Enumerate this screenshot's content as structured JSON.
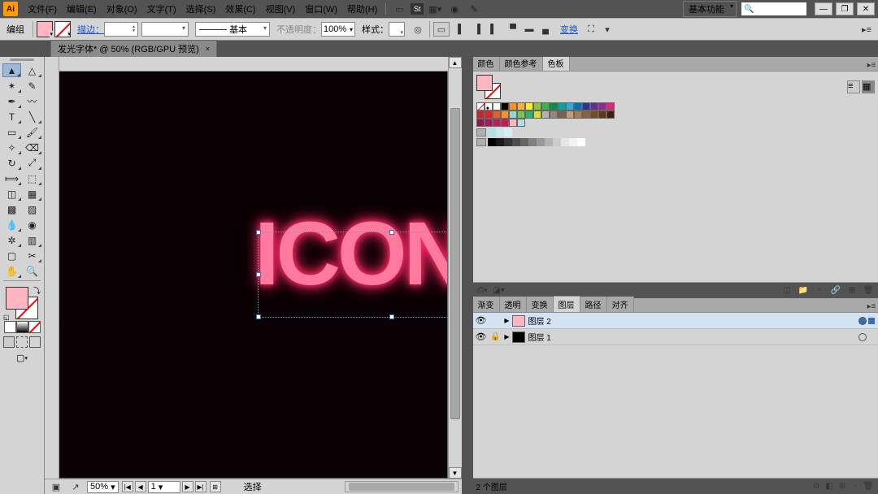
{
  "menu": {
    "file": "文件(F)",
    "edit": "编辑(E)",
    "object": "对象(O)",
    "type": "文字(T)",
    "select": "选择(S)",
    "effect": "效果(C)",
    "view": "视图(V)",
    "window": "窗口(W)",
    "help": "帮助(H)"
  },
  "workspace": "基本功能",
  "options": {
    "label": "编组",
    "stroke_link": "描边：",
    "basic_label": "基本",
    "opacity_label": "不透明度：",
    "opacity_value": "100%",
    "style_label": "样式：",
    "transform_link": "变换"
  },
  "doc_tab": {
    "title": "发光字体* @ 50% (RGB/GPU 预览)",
    "close": "×"
  },
  "canvas": {
    "text": "ICON"
  },
  "status": {
    "zoom": "50%",
    "artboard": "1",
    "mode": "选择"
  },
  "panels": {
    "color_tab": "颜色",
    "color_guide_tab": "颜色参考",
    "swatches_tab": "色板",
    "gradient_tab": "渐变",
    "transparency_tab": "透明",
    "transform_tab2": "变换",
    "layers_tab": "图层",
    "paths_tab": "路径",
    "align_tab": "对齐"
  },
  "swatch_rows": [
    [
      "none",
      "reg",
      "#ffffff",
      "#000000",
      "#f7931e",
      "#fbb03b",
      "#fcee21",
      "#8cc63f",
      "#39b54a",
      "#009245",
      "#00a99d",
      "#29abe2",
      "#0071bc",
      "#2e3192",
      "#662d91",
      "#93278f",
      "#ed1e79"
    ],
    [
      "#c1272d",
      "#ed1c24",
      "#f15a24",
      "#f7931e",
      "#95d6d8",
      "#7ac943",
      "#22b573",
      "#d9e021",
      "#b3b3b3",
      "#998675",
      "#736357",
      "#c69c6d",
      "#a67c52",
      "#8c6239",
      "#754c24",
      "#603813",
      "#42210b"
    ],
    [
      "#8b1a4b",
      "#a3195b",
      "#bd1e59",
      "#d4145a",
      "#ffb6c1",
      "#b0e0e6"
    ]
  ],
  "gray_strip": [
    "#000000",
    "#1a1a1a",
    "#333333",
    "#4d4d4d",
    "#666666",
    "#808080",
    "#999999",
    "#b3b3b3",
    "#cccccc",
    "#e6e6e6",
    "#f2f2f2",
    "#ffffff"
  ],
  "tint_strip": [
    "#b0e0e6",
    "#c8e8ec",
    "#d6eff2"
  ],
  "layers": {
    "items": [
      {
        "name": "图层 2",
        "thumb": "#ffb6c1",
        "active": true,
        "locked": false,
        "selected": true
      },
      {
        "name": "图层 1",
        "thumb": "#000000",
        "active": false,
        "locked": true,
        "selected": false
      }
    ],
    "footer": "2 个图层"
  }
}
